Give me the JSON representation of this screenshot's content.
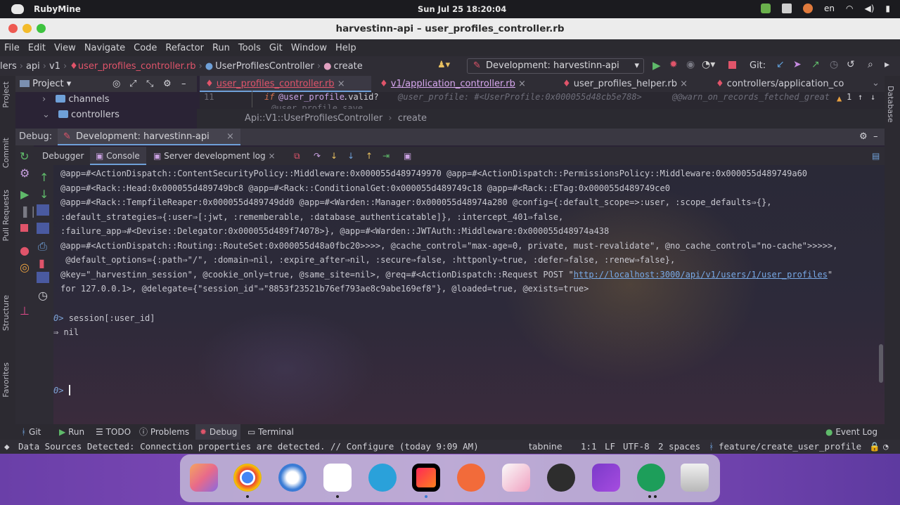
{
  "os_bar": {
    "app_name": "RubyMine",
    "clock": "Sun Jul 25   18:20:04",
    "lang": "en"
  },
  "window": {
    "title": "harvestinn-api – user_profiles_controller.rb"
  },
  "menu": [
    "File",
    "Edit",
    "View",
    "Navigate",
    "Code",
    "Refactor",
    "Run",
    "Tools",
    "Git",
    "Window",
    "Help"
  ],
  "navbar": {
    "crumbs": [
      "lers",
      "api",
      "v1"
    ],
    "file": "user_profiles_controller.rb",
    "class": "UserProfilesController",
    "method": "create",
    "run_config": "Development: harvestinn-api",
    "git_label": "Git:"
  },
  "project_panel": {
    "title": "Project",
    "items": [
      "channels",
      "controllers"
    ]
  },
  "editor_tabs": [
    "user_profiles_controller.rb",
    "v1/application_controller.rb",
    "user_profiles_helper.rb",
    "controllers/application_co"
  ],
  "editor": {
    "line_no": "11",
    "code_keyword": "if",
    "code_var": "@user_profile",
    "code_rest": ".valid?",
    "inline_hint": "@user_profile: #<UserProfile:0x000055d48cb5e788>",
    "inline_hint2": "@@warn_on_records_fetched_great",
    "warnings": "1",
    "next_line": "@user_profile.save"
  },
  "editor_breadcrumb": {
    "class": "Api::V1::UserProfilesController",
    "method": "create"
  },
  "debug": {
    "label": "Debug:",
    "session": "Development: harvestinn-api",
    "tabs": [
      "Debugger",
      "Console",
      "Server development log"
    ]
  },
  "console": {
    "lines": [
      "@app=#<ActionDispatch::ContentSecurityPolicy::Middleware:0x000055d489749970 @app=#<ActionDispatch::PermissionsPolicy::Middleware:0x000055d489749a60",
      "@app=#<Rack::Head:0x000055d489749bc8 @app=#<Rack::ConditionalGet:0x000055d489749c18 @app=#<Rack::ETag:0x000055d489749ce0",
      "@app=#<Rack::TempfileReaper:0x000055d489749dd0 @app=#<Warden::Manager:0x000055d48974a280 @config={:default_scope=>:user, :scope_defaults⇒{},",
      ":default_strategies⇒{:user⇒[:jwt, :rememberable, :database_authenticatable]}, :intercept_401⇒false,",
      ":failure_app⇒#<Devise::Delegator:0x000055d489f74078>}, @app=#<Warden::JWTAuth::Middleware:0x000055d48974a438",
      "@app=#<ActionDispatch::Routing::RouteSet:0x000055d48a0fbc20>>>>, @cache_control=\"max-age=0, private, must-revalidate\", @no_cache_control=\"no-cache\">>>>>,",
      " @default_options={:path⇒\"/\", :domain⇒nil, :expire_after⇒nil, :secure⇒false, :httponly⇒true, :defer⇒false, :renew⇒false},",
      "@key=\"_harvestinn_session\", @cookie_only=true, @same_site=nil>, @req=#<ActionDispatch::Request POST \""
    ],
    "link": "http://localhost:3000/api/v1/users/1/user_profiles",
    "link_tail": "\"",
    "last_line": "for 127.0.0.1>, @delegate={\"session_id\"⇒\"8853f23521b76ef793ae8c9abe169ef8\"}, @loaded=true, @exists=true>",
    "prompt": "0>",
    "command": "session[:user_id]",
    "result": "⇒ nil",
    "prompt2": "0>"
  },
  "bottom_tabs": [
    "Git",
    "Run",
    "TODO",
    "Problems",
    "Debug",
    "Terminal"
  ],
  "event_log": "Event Log",
  "status": {
    "message": "Data Sources Detected: Connection properties are detected. // Configure (today 9:09 AM)",
    "tabnine": "tabnine",
    "position": "1:1",
    "line_sep": "LF",
    "encoding": "UTF-8",
    "indent": "2 spaces",
    "branch": "feature/create_user_profile"
  },
  "side_labels": {
    "left": [
      "Project",
      "Commit",
      "Pull Requests",
      "Structure",
      "Favorites"
    ],
    "right": [
      "Database"
    ]
  },
  "colors": {
    "accent_red": "#e0546a",
    "link_blue": "#78a9e6",
    "dock_purple": "#7b48b5"
  }
}
